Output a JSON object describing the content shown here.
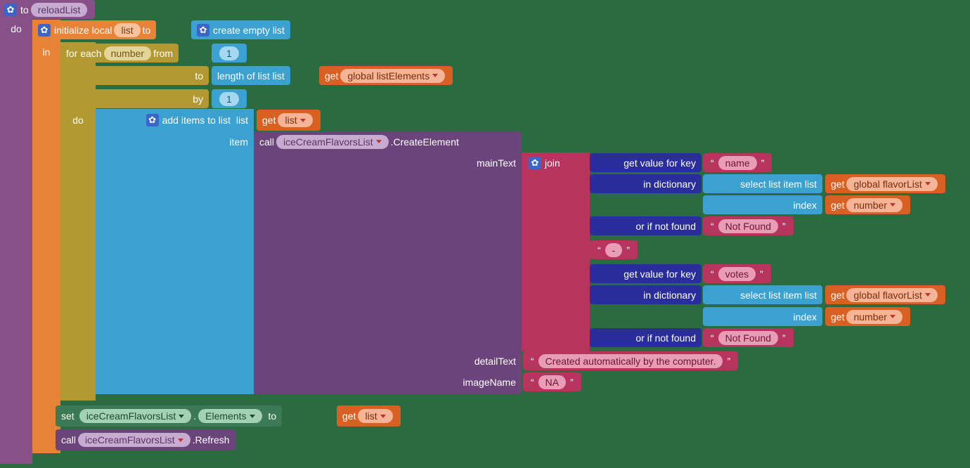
{
  "proc": {
    "to": "to",
    "name": "reloadList",
    "do": "do"
  },
  "init": {
    "label": "initialize local",
    "var": "list",
    "to": "to",
    "in": "in"
  },
  "createEmpty": "create empty list",
  "foreach": {
    "label": "for each",
    "var": "number",
    "from": "from",
    "to": "to",
    "by": "by",
    "do": "do",
    "fromVal": "1",
    "byVal": "1"
  },
  "lengthOf": "length of list  list",
  "get": "get",
  "globalListElements": "global listElements",
  "addItems": {
    "label": "add items to list",
    "list": "list",
    "item": "item"
  },
  "listVar": "list",
  "call": "call",
  "iceCreamFlavorsList": "iceCreamFlavorsList",
  "createElement": ".CreateElement",
  "mainText": "mainText",
  "detailText": "detailText",
  "imageName": "imageName",
  "join": "join",
  "getValKey": "get value for key",
  "inDict": "in dictionary",
  "orNotFound": "or if not found",
  "nameKey": "name",
  "votesKey": "votes",
  "notFound": "Not Found",
  "dash": " - ",
  "selectListItem": "select list item  list",
  "index": "index",
  "globalFlavorList": "global flavorList",
  "numberVar": "number",
  "createdAuto": "Created automatically by the computer.",
  "na": "NA",
  "set": "set",
  "elements": "Elements",
  "toWord": "to",
  "refresh": ".Refresh"
}
